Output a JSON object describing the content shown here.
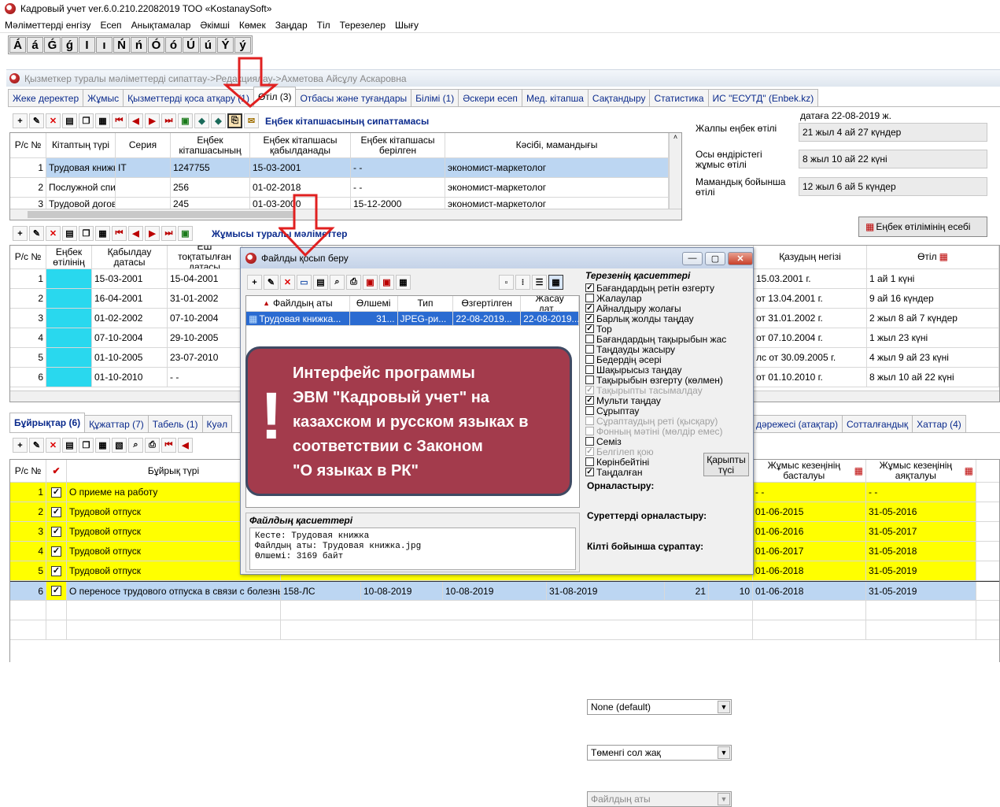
{
  "window": {
    "title": "Кадровый учет ver.6.0.210.22082019 ТОО «KostanaySoft»"
  },
  "menu": [
    "Мәліметтерді енгізу",
    "Есеп",
    "Анықтамалар",
    "Әкімші",
    "Көмек",
    "Заңдар",
    "Тіл",
    "Терезелер",
    "Шығу"
  ],
  "kazakh_chars": [
    "Á",
    "á",
    "Ǵ",
    "ǵ",
    "I",
    "ı",
    "Ń",
    "ń",
    "Ó",
    "ó",
    "Ú",
    "ú",
    "Ý",
    "ý"
  ],
  "breadcrumb": "Қызметкер туралы мәліметтерді сипаттау->Редакциялау->Ахметова Айсұлу Аскаровна",
  "top_tabs": [
    "Жеке деректер",
    "Жұмыс",
    "Қызметтерді қоса атқару (1)",
    "Өтіл (3)",
    "Отбасы және туғандары",
    "Білімі (1)",
    "Әскери есеп",
    "Мед. кітапша",
    "Сақтандыру",
    "Статистика",
    "ИС \"ЕСУТД\" (Enbek.kz)"
  ],
  "toolbar1": {
    "title": "Еңбек кітапшасының сипаттамасы"
  },
  "books_table": {
    "headers": [
      "Р/с №",
      "Кітаптың түрі",
      "Серия",
      "Еңбек кітапшасының",
      "Еңбек кітапшасы қабылданады",
      "Еңбек кітапшасы берілген",
      "Кәсібі, мамандығы"
    ],
    "rows": [
      [
        "1",
        "Трудовая книжка",
        "IT",
        "1247755",
        "15-03-2001",
        "- -",
        "экономист-маркетолог"
      ],
      [
        "2",
        "Послужной список",
        "",
        "256",
        "01-02-2018",
        "- -",
        "экономист-маркетолог"
      ],
      [
        "3",
        "Трудовой договор",
        "",
        "245",
        "01-03-2000",
        "15-12-2000",
        "экономист-маркетолог"
      ]
    ]
  },
  "experience": {
    "date_label": "датаға 22-08-2019 ж.",
    "items": [
      {
        "label": "Жалпы еңбек өтілі",
        "value": "21 жыл 4 ай 27 күндер"
      },
      {
        "label": "Осы өндірістегі жұмыс өтілі",
        "value": "8 жыл 10 ай 22 күні"
      },
      {
        "label": "Мамандық бойынша өтілі",
        "value": "12 жыл 6 ай 5 күндер"
      }
    ],
    "calc_button": "Еңбек өтілімінің есебі"
  },
  "toolbar2": {
    "title": "Жұмысы туралы мәліметтер"
  },
  "work_table": {
    "headers": [
      "Р/с №",
      "Еңбек өтілінің",
      "Қабылдау датасы",
      "ЕШ тоқтатылған датасы",
      "Қазудың негізі",
      "Өтіл"
    ],
    "rows": [
      [
        "1",
        "15-03-2001",
        "15-04-2001",
        "15.03.2001 г.",
        "1 ай 1 күні"
      ],
      [
        "2",
        "16-04-2001",
        "31-01-2002",
        "от 13.04.2001 г.",
        "9 ай 16 күндер"
      ],
      [
        "3",
        "01-02-2002",
        "07-10-2004",
        "от 31.01.2002 г.",
        "2 жыл 8 ай 7 күндер"
      ],
      [
        "4",
        "07-10-2004",
        "29-10-2005",
        "от 07.10.2004 г.",
        "1 жыл 23 күні"
      ],
      [
        "5",
        "01-10-2005",
        "23-07-2010",
        "лс от 30.09.2005 г.",
        "4 жыл 9 ай 23 күні"
      ],
      [
        "6",
        "01-10-2010",
        "- -",
        "от 01.10.2010 г.",
        "8 жыл 10 ай 22 күні"
      ]
    ]
  },
  "bottom_tabs_left": [
    "Бұйрықтар (6)",
    "Құжаттар (7)",
    "Табель (1)",
    "Куәл"
  ],
  "bottom_tabs_right": [
    "дәрежесі (атақтар)",
    "Сотталғандық",
    "Хаттар (4)"
  ],
  "orders_table": {
    "headers": [
      "Р/с №",
      "Бұйрық түрі",
      "Жұмыс кезеңінің басталуы",
      "Жұмыс кезеңінің аяқталуы"
    ],
    "rows": [
      {
        "n": "1",
        "type": "О приеме на работу",
        "start": "- -",
        "end": "- -"
      },
      {
        "n": "2",
        "type": "Трудовой отпуск",
        "start": "01-06-2015",
        "end": "31-05-2016"
      },
      {
        "n": "3",
        "type": "Трудовой отпуск",
        "start": "01-06-2016",
        "end": "31-05-2017"
      },
      {
        "n": "4",
        "type": "Трудовой отпуск",
        "start": "01-06-2017",
        "end": "31-05-2018"
      },
      {
        "n": "5",
        "type": "Трудовой отпуск",
        "start": "01-06-2018",
        "end": "31-05-2019"
      },
      {
        "n": "6",
        "type": "О переносе трудового отпуска в связи с болезнью",
        "num": "158-ЛС",
        "d1": "10-08-2019",
        "d2": "10-08-2019",
        "d3": "31-08-2019",
        "c1": "21",
        "c2": "10",
        "start": "01-06-2018",
        "end": "31-05-2019"
      }
    ]
  },
  "dialog": {
    "title": "Файлды қосып беру",
    "file_headers": [
      "Файлдың аты",
      "Өлшемі",
      "Тип",
      "Өзгертілген",
      "Жасау дат..."
    ],
    "file_row": [
      "Трудовая книжка...",
      "31...",
      "JPEG-ри...",
      "22-08-2019...",
      "22-08-2019..."
    ],
    "props_title": "Терезенің қасиеттері",
    "options": [
      {
        "label": "Бағандардың ретін өзгерту",
        "checked": true,
        "disabled": false
      },
      {
        "label": "Жалаулар",
        "checked": false,
        "disabled": false
      },
      {
        "label": "Айналдыру жолағы",
        "checked": true,
        "disabled": false
      },
      {
        "label": "Барлық жолды таңдау",
        "checked": true,
        "disabled": false
      },
      {
        "label": "Тор",
        "checked": true,
        "disabled": false
      },
      {
        "label": "Бағандардың тақырыбын жас",
        "checked": false,
        "disabled": false
      },
      {
        "label": "Таңдауды жасыру",
        "checked": false,
        "disabled": false
      },
      {
        "label": "Бедердің әсері",
        "checked": false,
        "disabled": false
      },
      {
        "label": "Шақырысыз таңдау",
        "checked": false,
        "disabled": false
      },
      {
        "label": "Тақырыбын өзгерту (көлмен)",
        "checked": false,
        "disabled": false
      },
      {
        "label": "Тақырыпты тасымалдау",
        "checked": true,
        "disabled": true
      },
      {
        "label": "Мульти таңдау",
        "checked": true,
        "disabled": false
      },
      {
        "label": "Сұрыптау",
        "checked": false,
        "disabled": false
      },
      {
        "label": "Сұраптаудың реті (қысқару)",
        "checked": false,
        "disabled": true
      },
      {
        "label": "Фонның мәтіні (мөлдір емес)",
        "checked": false,
        "disabled": true
      },
      {
        "label": "Семіз",
        "checked": false,
        "disabled": false
      },
      {
        "label": "Белгілеп қою",
        "checked": true,
        "disabled": true
      },
      {
        "label": "Көрінбейтіні",
        "checked": false,
        "disabled": false
      },
      {
        "label": "Таңдалған",
        "checked": true,
        "disabled": false
      }
    ],
    "font_button_line1": "Қарыпты",
    "font_button_line2": "түсі",
    "placement_label": "Орналастыру:",
    "placement_value": "None (default)",
    "image_placement_label": "Суреттерді орналастыру:",
    "image_placement_value": "Төменгі сол жақ",
    "key_sort_label": "Кілті бойынша сұраптау:",
    "key_sort_value": "Файлдың аты",
    "file_props_title": "Файлдың қасиеттері",
    "file_props_lines": [
      "Кесте: Трудовая книжка",
      "Файлдың аты: Трудовая книжка.jpg",
      "Өлшемі: 3169 байт"
    ]
  },
  "overlay": {
    "mark": "!",
    "lines": [
      "Интерфейс программы",
      "ЭВМ \"Кадровый учет\" на",
      "казахском и русском языках в",
      "соответствии с Законом",
      "\"О языках в РК\""
    ]
  }
}
